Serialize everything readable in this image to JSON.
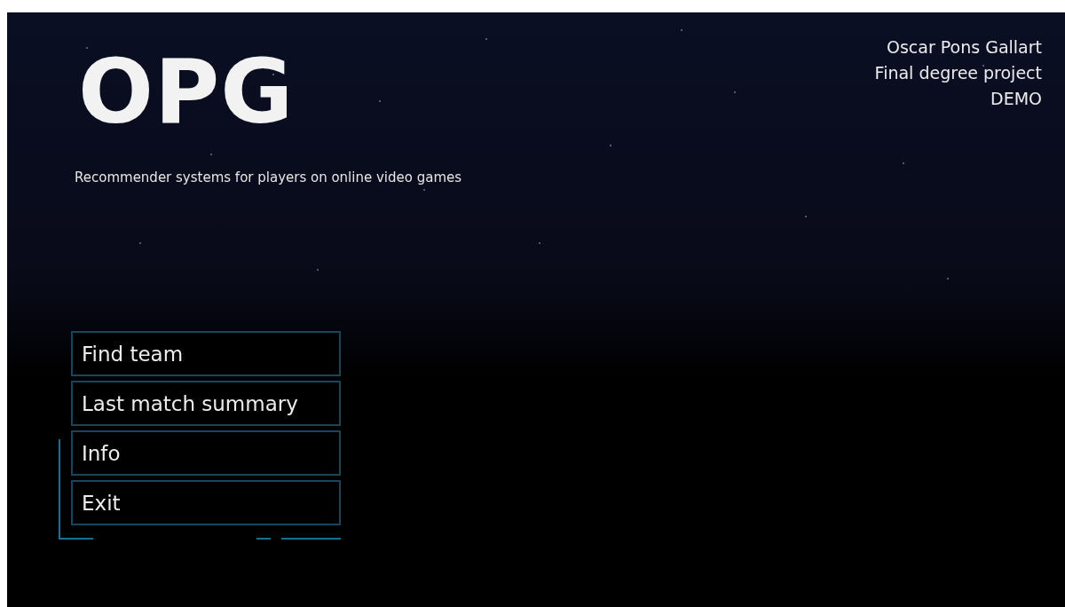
{
  "logo": "OPG",
  "subtitle": "Recommender systems for players on online video games",
  "credits": [
    "Oscar Pons Gallart",
    "Final degree project",
    "DEMO"
  ],
  "menu": [
    {
      "label": "Find team"
    },
    {
      "label": "Last match summary"
    },
    {
      "label": "Info"
    },
    {
      "label": "Exit"
    }
  ]
}
